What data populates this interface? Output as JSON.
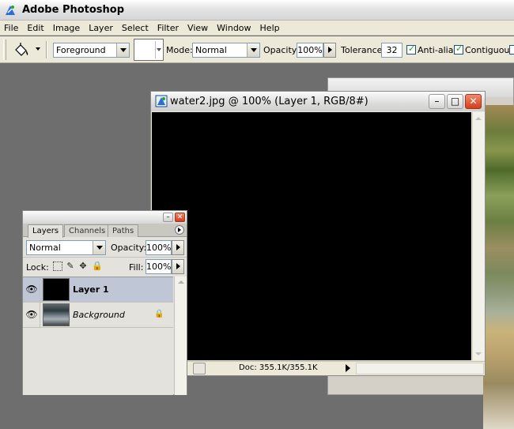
{
  "app": {
    "title": "Adobe Photoshop"
  },
  "menubar": {
    "items": [
      "File",
      "Edit",
      "Image",
      "Layer",
      "Select",
      "Filter",
      "View",
      "Window",
      "Help"
    ]
  },
  "options": {
    "fill_source": "Foreground",
    "mode_label": "Mode:",
    "mode_value": "Normal",
    "opacity_label": "Opacity:",
    "opacity_value": "100%",
    "tolerance_label": "Tolerance:",
    "tolerance_value": "32",
    "anti_alias_label": "Anti-alias",
    "anti_alias_checked": true,
    "contiguous_label": "Contiguous",
    "contiguous_checked": true
  },
  "document": {
    "title": "water2.jpg @ 100% (Layer 1, RGB/8#)",
    "status": "Doc: 355.1K/355.1K"
  },
  "layers_palette": {
    "tabs": [
      "Layers",
      "Channels",
      "Paths"
    ],
    "active_tab": "Layers",
    "blend_mode": "Normal",
    "opacity_label": "Opacity:",
    "opacity_value": "100%",
    "lock_label": "Lock:",
    "fill_label": "Fill:",
    "fill_value": "100%",
    "layers": [
      {
        "name": "Layer 1",
        "visible": true,
        "selected": true,
        "locked": false
      },
      {
        "name": "Background",
        "visible": true,
        "selected": false,
        "locked": true
      }
    ]
  },
  "colors": {
    "canvas": "#000000",
    "workspace": "#6e6e6e",
    "selected_layer": "#bfc6d6",
    "close_button": "#d43d1a"
  }
}
